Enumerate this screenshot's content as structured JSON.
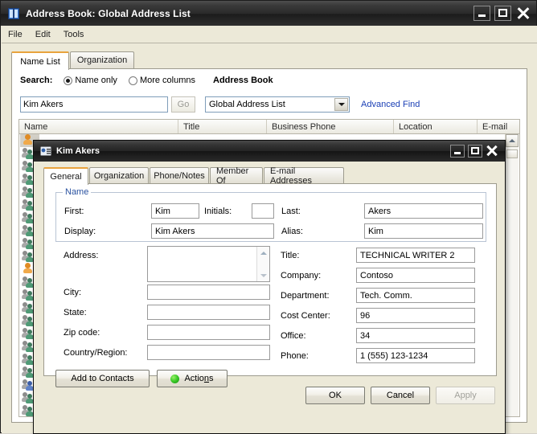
{
  "window": {
    "title": "Address Book: Global Address List",
    "icon": "address-book-icon",
    "controls": {
      "minimize": "Minimize",
      "maximize": "Maximize",
      "close": "Close"
    }
  },
  "menubar": {
    "items": [
      "File",
      "Edit",
      "Tools"
    ]
  },
  "tabs": {
    "items": [
      {
        "label": "Name List",
        "selected": true
      },
      {
        "label": "Organization",
        "selected": false
      }
    ]
  },
  "search": {
    "label": "Search:",
    "options": [
      {
        "label": "Name only",
        "selected": true
      },
      {
        "label": "More columns",
        "selected": false
      }
    ],
    "query_value": "Kim Akers",
    "query_placeholder": "",
    "go_label": "Go",
    "go_enabled": false,
    "address_book_label": "Address Book",
    "address_book_value": "Global Address List",
    "address_book_options": [
      "Global Address List"
    ],
    "advanced_find": "Advanced Find"
  },
  "list": {
    "columns": [
      "Name",
      "Title",
      "Business Phone",
      "Location",
      "E-mail"
    ],
    "rows": 22
  },
  "scrollbar": {
    "up": "Scroll up",
    "thumb": "Scroll thumb"
  },
  "dialog": {
    "title": "Kim Akers",
    "icon": "contact-card-icon",
    "controls": {
      "minimize": "Minimize",
      "maximize": "Maximize",
      "close": "Close"
    },
    "tabs": [
      {
        "label": "General",
        "selected": true
      },
      {
        "label": "Organization",
        "selected": false
      },
      {
        "label": "Phone/Notes",
        "selected": false
      },
      {
        "label": "Member Of",
        "selected": false
      },
      {
        "label": "E-mail Addresses",
        "selected": false
      }
    ],
    "name_group": {
      "legend": "Name",
      "first_label": "First:",
      "first_value": "Kim",
      "initials_label": "Initials:",
      "initials_value": "",
      "last_label": "Last:",
      "last_value": "Akers",
      "display_label": "Display:",
      "display_value": "Kim Akers",
      "alias_label": "Alias:",
      "alias_value": "Kim"
    },
    "left_fields": [
      {
        "label": "Address:",
        "value": ""
      },
      {
        "label": "City:",
        "value": ""
      },
      {
        "label": "State:",
        "value": ""
      },
      {
        "label": "Zip code:",
        "value": ""
      },
      {
        "label": "Country/Region:",
        "value": ""
      }
    ],
    "right_fields": [
      {
        "label": "Title:",
        "value": "TECHNICAL WRITER 2"
      },
      {
        "label": "Company:",
        "value": "Contoso"
      },
      {
        "label": "Department:",
        "value": "Tech. Comm."
      },
      {
        "label": "Cost Center:",
        "value": "96"
      },
      {
        "label": "Office:",
        "value": "34"
      },
      {
        "label": "Phone:",
        "value": "1 (555) 123-1234"
      }
    ],
    "add_to_contacts_label": "Add to Contacts",
    "actions_label_pre": "Actio",
    "actions_label_accel": "n",
    "actions_label_post": "s",
    "footer": {
      "ok": "OK",
      "cancel": "Cancel",
      "apply": "Apply",
      "apply_enabled": false
    }
  },
  "colors": {
    "accent_tab": "#e8a33d",
    "link": "#1a3fb5",
    "group_legend": "#2a52a0",
    "window_face": "#ece9d8",
    "titlebar_dark": "#242424"
  }
}
